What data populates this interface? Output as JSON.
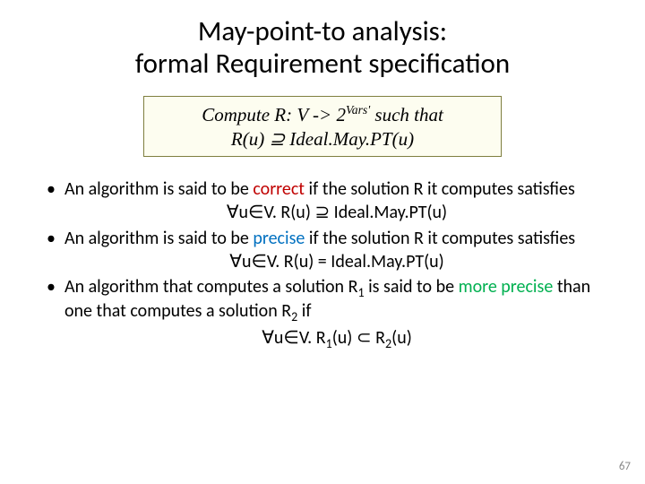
{
  "title_line1": "May-point-to analysis:",
  "title_line2": "formal Requirement specification",
  "formula": {
    "line1_pre": "Compute R: V -> 2",
    "line1_sup": "Vars'",
    "line1_post": " such that",
    "line2": "R(u) ⊇ Ideal.May.PT(u)"
  },
  "bullets": {
    "b1_pre": "An algorithm is said to be ",
    "b1_kw": "correct",
    "b1_post": " if the solution R it computes satisfies",
    "b1_math": "∀u∈V. R(u) ⊇ Ideal.May.PT(u)",
    "b2_pre": "An algorithm is said to be ",
    "b2_kw": "precise",
    "b2_post": " if the solution R it computes satisfies",
    "b2_math": "∀u∈V. R(u) = Ideal.May.PT(u)",
    "b3_pre": "An algorithm that computes a solution R",
    "b3_sub1": "1",
    "b3_mid": " is said to be ",
    "b3_kw": "more precise",
    "b3_mid2": " than one that computes a solution R",
    "b3_sub2": "2",
    "b3_post": " if",
    "b3_math_pre": "∀u∈V. R",
    "b3_math_s1": "1",
    "b3_math_mid": "(u) ⊂ R",
    "b3_math_s2": "2",
    "b3_math_post": "(u)"
  },
  "slide_number": "67"
}
